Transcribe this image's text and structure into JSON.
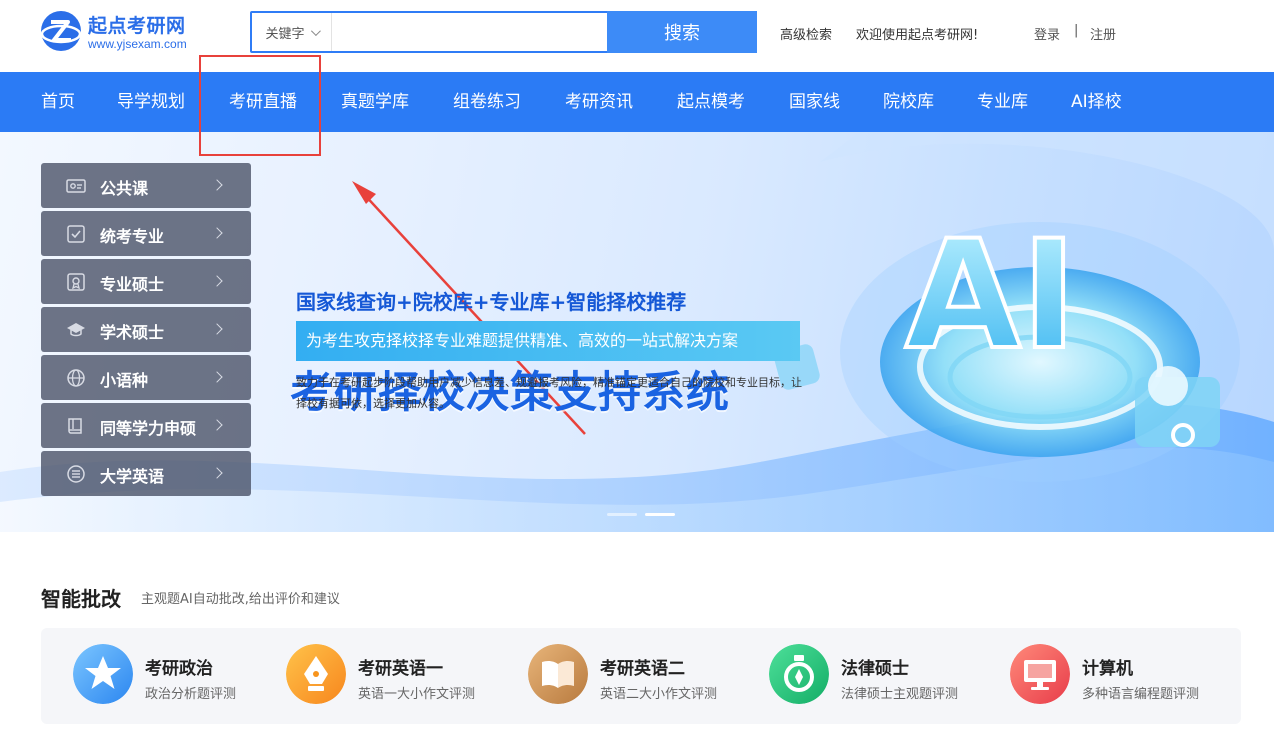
{
  "header": {
    "logo_name": "起点考研网",
    "logo_url": "www.yjsexam.com",
    "search": {
      "type_label": "关键字",
      "placeholder": "",
      "button_label": "搜索"
    },
    "advanced_search": "高级检索",
    "welcome": "欢迎使用起点考研网!",
    "login": "登录",
    "separator": "|",
    "register": "注册"
  },
  "nav": {
    "items": [
      {
        "label": "首页"
      },
      {
        "label": "导学规划"
      },
      {
        "label": "考研直播"
      },
      {
        "label": "真题学库"
      },
      {
        "label": "组卷练习"
      },
      {
        "label": "考研资讯"
      },
      {
        "label": "起点模考"
      },
      {
        "label": "国家线"
      },
      {
        "label": "院校库"
      },
      {
        "label": "专业库"
      },
      {
        "label": "AI择校"
      }
    ],
    "highlighted_item": "考研直播"
  },
  "sidebar": {
    "items": [
      {
        "label": "公共课",
        "icon": "id-card-icon"
      },
      {
        "label": "统考专业",
        "icon": "checklist-icon"
      },
      {
        "label": "专业硕士",
        "icon": "certificate-icon"
      },
      {
        "label": "学术硕士",
        "icon": "graduation-cap-icon"
      },
      {
        "label": "小语种",
        "icon": "globe-icon"
      },
      {
        "label": "同等学力申硕",
        "icon": "book-icon"
      },
      {
        "label": "大学英语",
        "icon": "list-icon"
      }
    ]
  },
  "banner": {
    "title": "考研择校决策支持系统",
    "subtitle": "国家线查询+院校库+专业库+智能择校推荐",
    "tagline": "为考生攻克择校择专业难题提供精准、高效的一站式解决方案",
    "description": "致力于在考研起步阶段帮助用户减少信息差、规避报考风险，精准锚定更适合自己的院校和专业目标，让择校有据可依，选择更加从容。",
    "graphic_text": "AI",
    "slides_count": 2,
    "active_slide": 2
  },
  "ai_review": {
    "title": "智能批改",
    "subtitle": "主观题AI自动批改,给出评价和建议",
    "cards": [
      {
        "title": "考研政治",
        "desc": "政治分析题评测",
        "icon": "star-icon",
        "color": "#3aa0f5"
      },
      {
        "title": "考研英语一",
        "desc": "英语一大小作文评测",
        "icon": "pen-nib-icon",
        "color": "#f7941d"
      },
      {
        "title": "考研英语二",
        "desc": "英语二大小作文评测",
        "icon": "open-book-icon",
        "color": "#c88a4a"
      },
      {
        "title": "法律硕士",
        "desc": "法律硕士主观题评测",
        "icon": "medal-icon",
        "color": "#1fbf75"
      },
      {
        "title": "计算机",
        "desc": "多种语言编程题评测",
        "icon": "monitor-icon",
        "color": "#f0534f"
      }
    ]
  },
  "colors": {
    "brand_blue": "#2b7bf5",
    "highlight_red": "#e8413b",
    "banner_title": "#1a63e2"
  }
}
